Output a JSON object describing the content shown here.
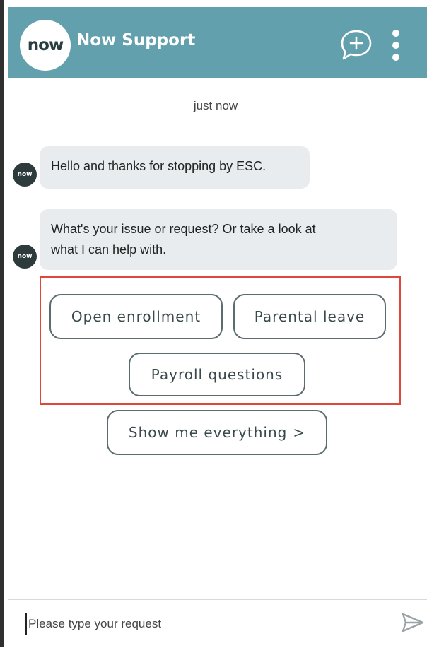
{
  "header": {
    "logo_text": "now",
    "title": "Now Support",
    "icons": {
      "new_chat": "chat-plus-icon",
      "menu": "kebab-menu-icon",
      "send": "send-icon"
    }
  },
  "chat": {
    "timestamp": "just now",
    "avatar_text": "now",
    "messages": [
      {
        "text": "Hello and thanks for stopping by ESC."
      },
      {
        "text_line1": "What's your issue or request? Or take a look at",
        "text_line2": "what I can help with."
      }
    ],
    "options": [
      {
        "label": "Open enrollment"
      },
      {
        "label": "Parental leave"
      },
      {
        "label": "Payroll questions"
      }
    ],
    "show_all": {
      "label": "Show me everything",
      "chevron": ">"
    }
  },
  "composer": {
    "placeholder": "Please type your request",
    "value": ""
  },
  "colors": {
    "header_bg": "#63a0ad",
    "highlight": "#e0463a",
    "bubble_bg": "#e8ecee"
  }
}
